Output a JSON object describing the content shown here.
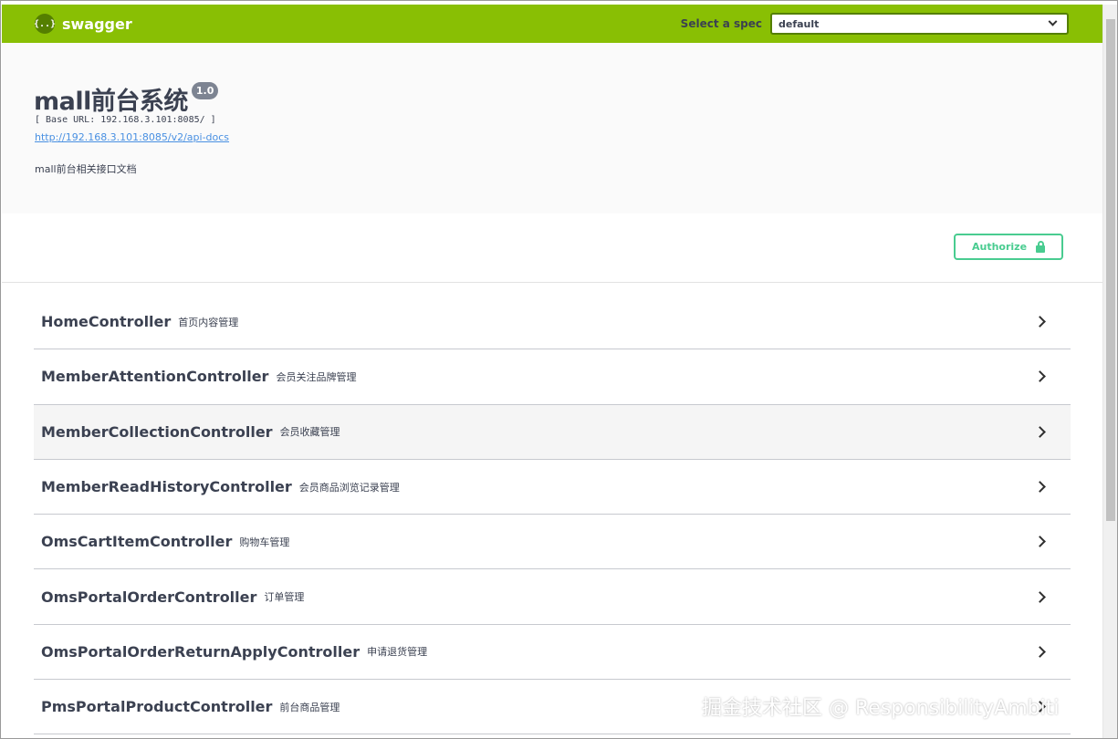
{
  "topbar": {
    "logo_text": "swagger",
    "logo_icon_text": "{..}",
    "spec_label": "Select a spec",
    "spec_value": "default"
  },
  "info": {
    "title": "mall前台系统",
    "version": "1.0",
    "base_url": "[ Base URL: 192.168.3.101:8085/ ]",
    "docs_link": "http://192.168.3.101:8085/v2/api-docs",
    "description": "mall前台相关接口文档"
  },
  "auth": {
    "label": "Authorize"
  },
  "controllers": [
    {
      "name": "HomeController",
      "desc": "首页内容管理"
    },
    {
      "name": "MemberAttentionController",
      "desc": "会员关注品牌管理"
    },
    {
      "name": "MemberCollectionController",
      "desc": "会员收藏管理"
    },
    {
      "name": "MemberReadHistoryController",
      "desc": "会员商品浏览记录管理"
    },
    {
      "name": "OmsCartItemController",
      "desc": "购物车管理"
    },
    {
      "name": "OmsPortalOrderController",
      "desc": "订单管理"
    },
    {
      "name": "OmsPortalOrderReturnApplyController",
      "desc": "申请退货管理"
    },
    {
      "name": "PmsPortalProductController",
      "desc": "前台商品管理"
    }
  ],
  "watermark": "掘金技术社区 @ ResponsibilityAmbiti",
  "colors": {
    "topbar": "#89bf04",
    "authorize": "#49cc90",
    "link": "#4990e2",
    "text": "#3b4151"
  }
}
